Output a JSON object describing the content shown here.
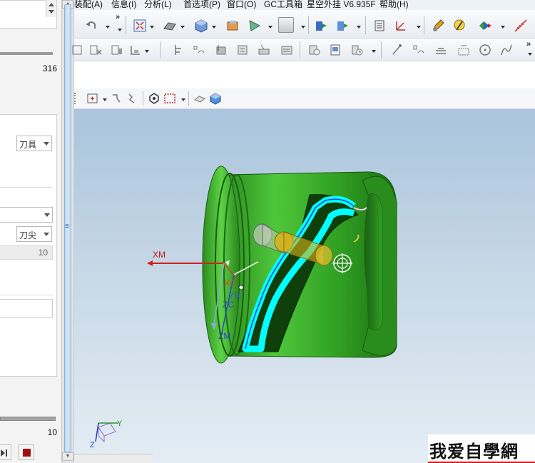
{
  "menubar": {
    "items": [
      "装配(A)",
      "信息(I)",
      "分析(L)",
      "首选项(P)",
      "窗口(O)",
      "GC工具箱",
      "星空外挂 V6.935F",
      "帮助(H)"
    ]
  },
  "left_panel": {
    "value_top": "316",
    "tool_combo": "刀具",
    "tip_combo": "刀尖",
    "value_mid": "10",
    "value_bottom": "10"
  },
  "viewport": {
    "axis_labels": {
      "xm": "XM",
      "xc": "XC",
      "ym": "YM",
      "zc": "ZC",
      "zm": "ZM",
      "triad_y": "Y",
      "triad_z": "Z"
    },
    "colors": {
      "part_green": "#2f9e22",
      "toolpath_cyan": "#00ffff",
      "tool_yellow": "#d8b21a",
      "background_top": "#aac4dd",
      "background_bottom": "#e4edf4"
    }
  },
  "watermark": {
    "text": "我爱自學網"
  }
}
